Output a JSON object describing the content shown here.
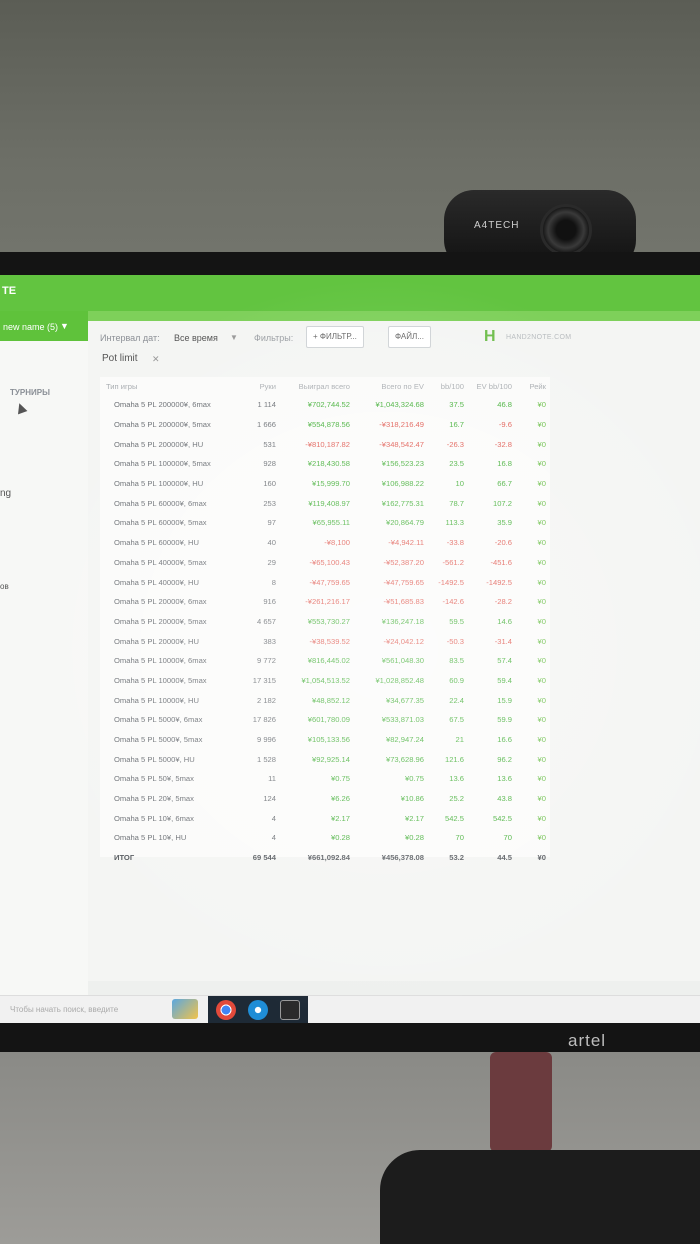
{
  "webcam": {
    "brand": "A4TECH"
  },
  "monitor": {
    "brand": "artel"
  },
  "app": {
    "title": "TE"
  },
  "sidebar": {
    "profile_name": "new name (5)",
    "tab_tournaments": "ТУРНИРЫ",
    "fragment1": "ng",
    "fragment2": "ов"
  },
  "toolbar": {
    "interval_label": "Интервал дат:",
    "interval_value": "Все время",
    "filters_label": "Фильтры:",
    "filter_button": "+ ФИЛЬТР...",
    "file_button": "ФАЙЛ...",
    "logo_text": "HAND2NOTE.COM"
  },
  "chip": {
    "label": "Pot limit"
  },
  "table": {
    "headers": [
      "Тип игры",
      "Руки",
      "Выиграл всего",
      "Всего по EV",
      "bb/100",
      "EV bb/100",
      "Рейк"
    ],
    "rows": [
      [
        "Omaha 5 PL 200000¥, 6max",
        "1 114",
        "¥702,744.52",
        "¥1,043,324.68",
        "37.5",
        "46.8",
        "¥0"
      ],
      [
        "Omaha 5 PL 200000¥, 5max",
        "1 666",
        "¥554,878.56",
        "-¥318,216.49",
        "16.7",
        "-9.6",
        "¥0"
      ],
      [
        "Omaha 5 PL 200000¥, HU",
        "531",
        "-¥810,187.82",
        "-¥348,542.47",
        "-26.3",
        "-32.8",
        "¥0"
      ],
      [
        "Omaha 5 PL 100000¥, 5max",
        "928",
        "¥218,430.58",
        "¥156,523.23",
        "23.5",
        "16.8",
        "¥0"
      ],
      [
        "Omaha 5 PL 100000¥, HU",
        "160",
        "¥15,999.70",
        "¥106,988.22",
        "10",
        "66.7",
        "¥0"
      ],
      [
        "Omaha 5 PL 60000¥, 6max",
        "253",
        "¥119,408.97",
        "¥162,775.31",
        "78.7",
        "107.2",
        "¥0"
      ],
      [
        "Omaha 5 PL 60000¥, 5max",
        "97",
        "¥65,955.11",
        "¥20,864.79",
        "113.3",
        "35.9",
        "¥0"
      ],
      [
        "Omaha 5 PL 60000¥, HU",
        "40",
        "-¥8,100",
        "-¥4,942.11",
        "-33.8",
        "-20.6",
        "¥0"
      ],
      [
        "Omaha 5 PL 40000¥, 5max",
        "29",
        "-¥65,100.43",
        "-¥52,387.20",
        "-561.2",
        "-451.6",
        "¥0"
      ],
      [
        "Omaha 5 PL 40000¥, HU",
        "8",
        "-¥47,759.65",
        "-¥47,759.65",
        "-1492.5",
        "-1492.5",
        "¥0"
      ],
      [
        "Omaha 5 PL 20000¥, 6max",
        "916",
        "-¥261,216.17",
        "-¥51,685.83",
        "-142.6",
        "-28.2",
        "¥0"
      ],
      [
        "Omaha 5 PL 20000¥, 5max",
        "4 657",
        "¥553,730.27",
        "¥136,247.18",
        "59.5",
        "14.6",
        "¥0"
      ],
      [
        "Omaha 5 PL 20000¥, HU",
        "383",
        "-¥38,539.52",
        "-¥24,042.12",
        "-50.3",
        "-31.4",
        "¥0"
      ],
      [
        "Omaha 5 PL 10000¥, 6max",
        "9 772",
        "¥816,445.02",
        "¥561,048.30",
        "83.5",
        "57.4",
        "¥0"
      ],
      [
        "Omaha 5 PL 10000¥, 5max",
        "17 315",
        "¥1,054,513.52",
        "¥1,028,852.48",
        "60.9",
        "59.4",
        "¥0"
      ],
      [
        "Omaha 5 PL 10000¥, HU",
        "2 182",
        "¥48,852.12",
        "¥34,677.35",
        "22.4",
        "15.9",
        "¥0"
      ],
      [
        "Omaha 5 PL 5000¥, 6max",
        "17 826",
        "¥601,780.09",
        "¥533,871.03",
        "67.5",
        "59.9",
        "¥0"
      ],
      [
        "Omaha 5 PL 5000¥, 5max",
        "9 996",
        "¥105,133.56",
        "¥82,947.24",
        "21",
        "16.6",
        "¥0"
      ],
      [
        "Omaha 5 PL 5000¥, HU",
        "1 528",
        "¥92,925.14",
        "¥73,628.96",
        "121.6",
        "96.2",
        "¥0"
      ],
      [
        "Omaha 5 PL 50¥, 5max",
        "11",
        "¥0.75",
        "¥0.75",
        "13.6",
        "13.6",
        "¥0"
      ],
      [
        "Omaha 5 PL 20¥, 5max",
        "124",
        "¥6.26",
        "¥10.86",
        "25.2",
        "43.8",
        "¥0"
      ],
      [
        "Omaha 5 PL 10¥, 6max",
        "4",
        "¥2.17",
        "¥2.17",
        "542.5",
        "542.5",
        "¥0"
      ],
      [
        "Omaha 5 PL 10¥, HU",
        "4",
        "¥0.28",
        "¥0.28",
        "70",
        "70",
        "¥0"
      ]
    ],
    "total": [
      "ИТОГ",
      "69 544",
      "¥661,092.84",
      "¥456,378.08",
      "53.2",
      "44.5",
      "¥0"
    ]
  },
  "taskbar": {
    "search_placeholder": "Чтобы начать поиск, введите"
  }
}
